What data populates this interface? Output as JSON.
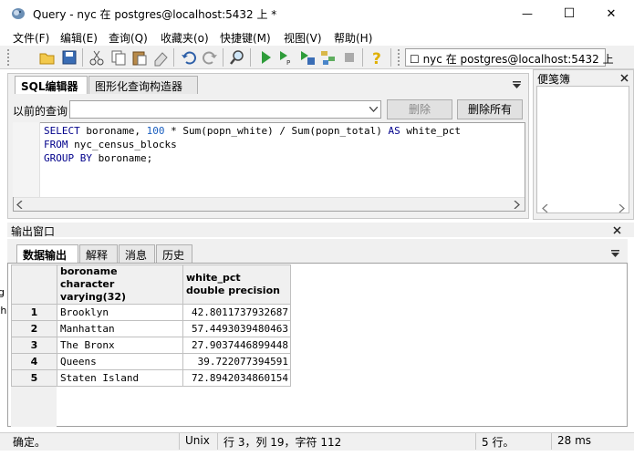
{
  "window": {
    "title": "Query - nyc 在  postgres@localhost:5432 上 *",
    "buttons": {
      "minimize": "—",
      "maximize": "☐",
      "close": "✕"
    }
  },
  "menu": [
    "文件(F)",
    "编辑(E)",
    "查询(Q)",
    "收藏夹(o)",
    "快捷键(M)",
    "视图(V)",
    "帮助(H)"
  ],
  "toolbar": {
    "connection": "☐ nyc 在  postgres@localhost:5432 上",
    "icons": [
      "open-icon",
      "save-icon",
      "cut-icon",
      "copy-icon",
      "paste-icon",
      "clear-icon",
      "undo-icon",
      "redo-icon",
      "find-icon",
      "execute-icon",
      "explain-icon",
      "execute-file-icon",
      "explain-analyze-icon",
      "stop-icon",
      "help-icon"
    ]
  },
  "editor": {
    "tabs": [
      "SQL编辑器",
      "图形化查询构造器"
    ],
    "history_label": "以前的查询",
    "delete_button": "删除",
    "delete_all_button": "删除所有",
    "lines": {
      "l1_kw1": "SELECT",
      "l1_rest1": " boroname, ",
      "l1_num": "100",
      "l1_rest2": " * Sum(popn_white) / Sum(popn_total) ",
      "l1_kw2": "AS",
      "l1_rest3": " white_pct",
      "l2_kw": "FROM",
      "l2_rest": " nyc_census_blocks",
      "l3_kw": "GROUP BY",
      "l3_rest": " boroname;"
    }
  },
  "scratch_pad": {
    "title": "便笺簿"
  },
  "output": {
    "title": "输出窗口",
    "tabs": [
      "数据输出",
      "解释",
      "消息",
      "历史"
    ],
    "columns": [
      {
        "name": "boroname",
        "type": "character varying(32)"
      },
      {
        "name": "white_pct",
        "type": "double precision"
      }
    ],
    "rows": [
      {
        "num": "1",
        "boroname": "Brooklyn",
        "white_pct": "42.8011737932687"
      },
      {
        "num": "2",
        "boroname": "Manhattan",
        "white_pct": "57.4493039480463"
      },
      {
        "num": "3",
        "boroname": "The Bronx",
        "white_pct": "27.9037446899448"
      },
      {
        "num": "4",
        "boroname": "Queens",
        "white_pct": "39.722077394591"
      },
      {
        "num": "5",
        "boroname": "Staten Island",
        "white_pct": "72.8942034860154"
      }
    ]
  },
  "left_strip": {
    "a": "g",
    "b": "th"
  },
  "status": {
    "state": "确定。",
    "line_ending": "Unix",
    "position": "行 3，列 19，字符 112",
    "rows": "5 行。",
    "time": "28 ms"
  }
}
